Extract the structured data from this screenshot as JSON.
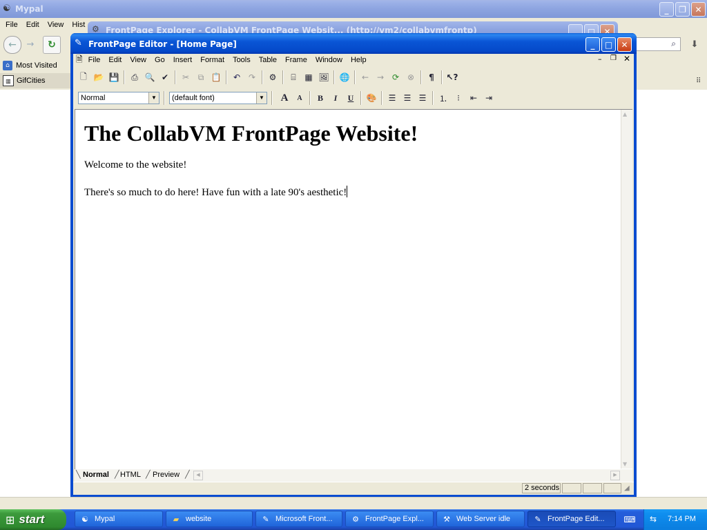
{
  "browser": {
    "title": "Mypal",
    "menu": [
      "File",
      "Edit",
      "View",
      "Hist"
    ],
    "bookmarks": [
      "Most Visited",
      "GifCities"
    ]
  },
  "explorer": {
    "title": "FrontPage Explorer - CollabVM FrontPage Websit... (http://vm2/collabvmfrontp)"
  },
  "editor": {
    "title": "FrontPage Editor - [Home Page]",
    "menu": [
      "File",
      "Edit",
      "View",
      "Go",
      "Insert",
      "Format",
      "Tools",
      "Table",
      "Frame",
      "Window",
      "Help"
    ],
    "style_combo": "Normal",
    "font_combo": "(default font)",
    "heading": "The CollabVM FrontPage Website!",
    "paragraph1": "Welcome to the website!",
    "paragraph2": "There's so much to do here! Have fun with a late 90's aesthetic!",
    "tabs": [
      "Normal",
      "HTML",
      "Preview"
    ],
    "active_tab": "Normal",
    "status_time": "2 seconds"
  },
  "taskbar": {
    "start": "start",
    "items": [
      {
        "label": "Mypal",
        "icon": "mypal-icon"
      },
      {
        "label": "website",
        "icon": "folder-icon"
      },
      {
        "label": "Microsoft Front...",
        "icon": "frontpage-icon"
      },
      {
        "label": "FrontPage Expl...",
        "icon": "explorer-icon"
      },
      {
        "label": "Web Server idle",
        "icon": "web-server-icon"
      },
      {
        "label": "FrontPage Edit...",
        "icon": "frontpage-editor-icon"
      }
    ],
    "clock": "7:14 PM"
  },
  "colors": {
    "taskbar": "#245edb",
    "start": "#3c9a3c",
    "tray": "#0f8ff0"
  }
}
